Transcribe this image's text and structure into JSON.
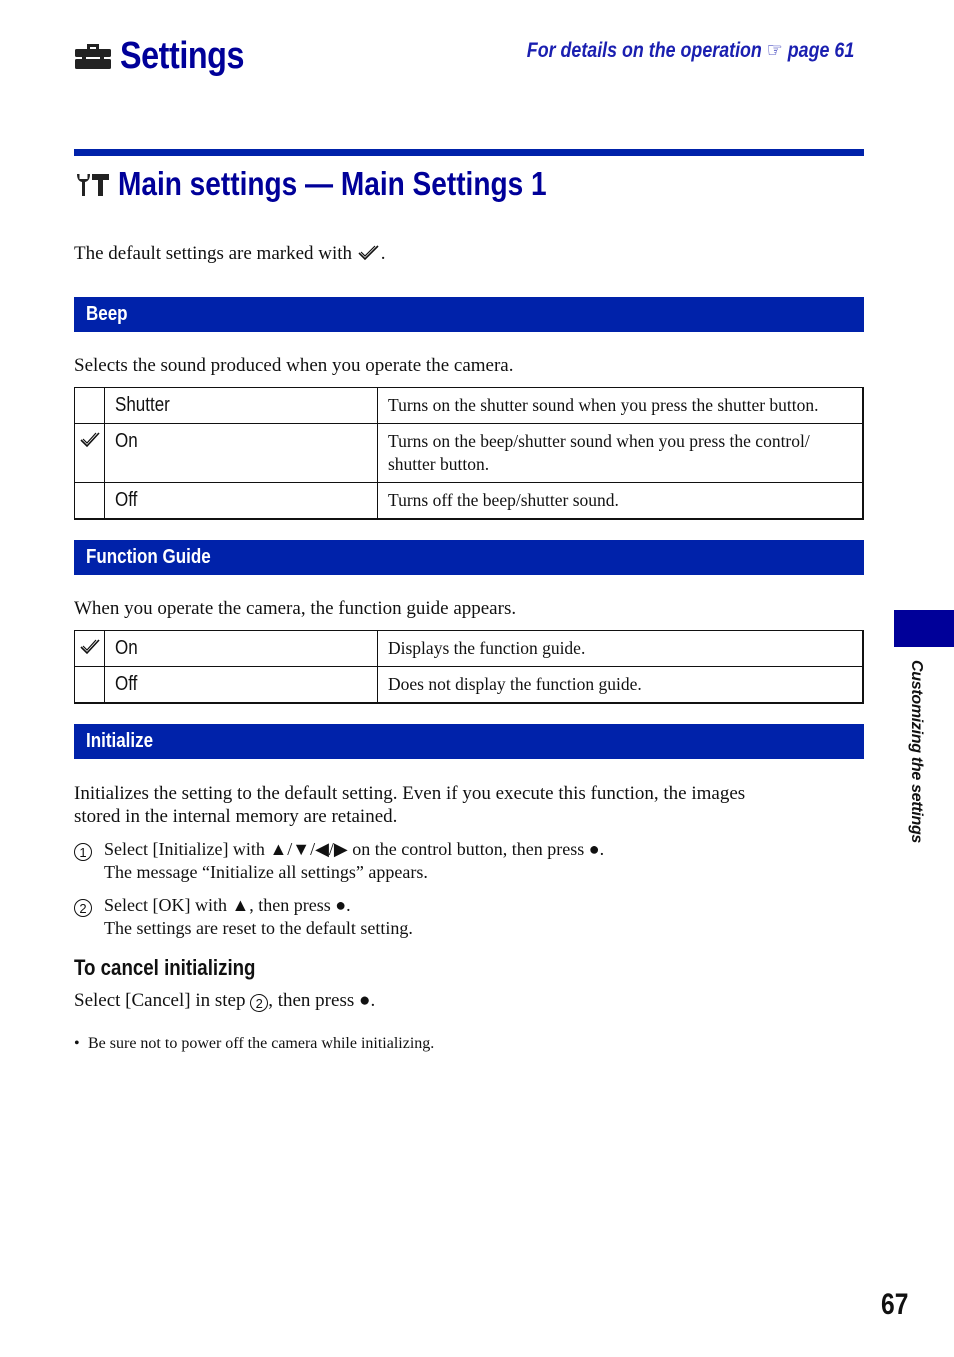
{
  "header": {
    "title": "Settings",
    "title_icon": "toolbox-icon",
    "reference_text": "For details on the operation",
    "reference_icon": "pointing-hand-icon",
    "reference_glyph": "☞",
    "reference_page": "page 61"
  },
  "section": {
    "title": "Main settings — Main Settings 1",
    "icon": "wrench-hammer-icon",
    "default_note_prefix": "The default settings are marked with",
    "default_note_suffix": "."
  },
  "beep": {
    "title": "Beep",
    "description": "Selects the sound produced when you operate the camera.",
    "options": [
      {
        "default": false,
        "name": "Shutter",
        "description": "Turns on the shutter sound when you press the shutter button."
      },
      {
        "default": true,
        "name": "On",
        "description": "Turns on the beep/shutter sound when you press the control/ shutter button."
      },
      {
        "default": false,
        "name": "Off",
        "description": "Turns off the beep/shutter sound."
      }
    ]
  },
  "function_guide": {
    "title": "Function Guide",
    "description": "When you operate the camera, the function guide appears.",
    "options": [
      {
        "default": true,
        "name": "On",
        "description": "Displays the function guide."
      },
      {
        "default": false,
        "name": "Off",
        "description": "Does not display the function guide."
      }
    ]
  },
  "initialize": {
    "title": "Initialize",
    "description_line1": "Initializes the setting to the default setting. Even if you execute this function, the images",
    "description_line2": "stored in the internal memory are retained.",
    "steps": [
      {
        "number": "1",
        "line1_pre": "Select [Initialize] with",
        "line1_arrows": "▲/▼/◀/▶",
        "line1_post": "on the control button, then press",
        "line1_end": ".",
        "line2": "The message “Initialize all settings” appears."
      },
      {
        "number": "2",
        "line1_pre": "Select [OK] with",
        "line1_arrows": "▲",
        "line1_post": ", then press",
        "line1_end": ".",
        "line2": "The settings are reset to the default setting."
      }
    ],
    "cancel_heading": "To cancel initializing",
    "cancel_pre": "Select [Cancel] in step",
    "cancel_step": "2",
    "cancel_post": ", then press",
    "cancel_end": ".",
    "note_bullet": "•",
    "note": "Be sure not to power off the camera while initializing."
  },
  "sidebar": {
    "label": "Customizing the settings"
  },
  "footer": {
    "page_number": "67"
  },
  "colors": {
    "title_blue": "#000099",
    "bar_blue": "#0022aa",
    "link_blue": "#1a1fb0",
    "side_tab": "#000099"
  }
}
